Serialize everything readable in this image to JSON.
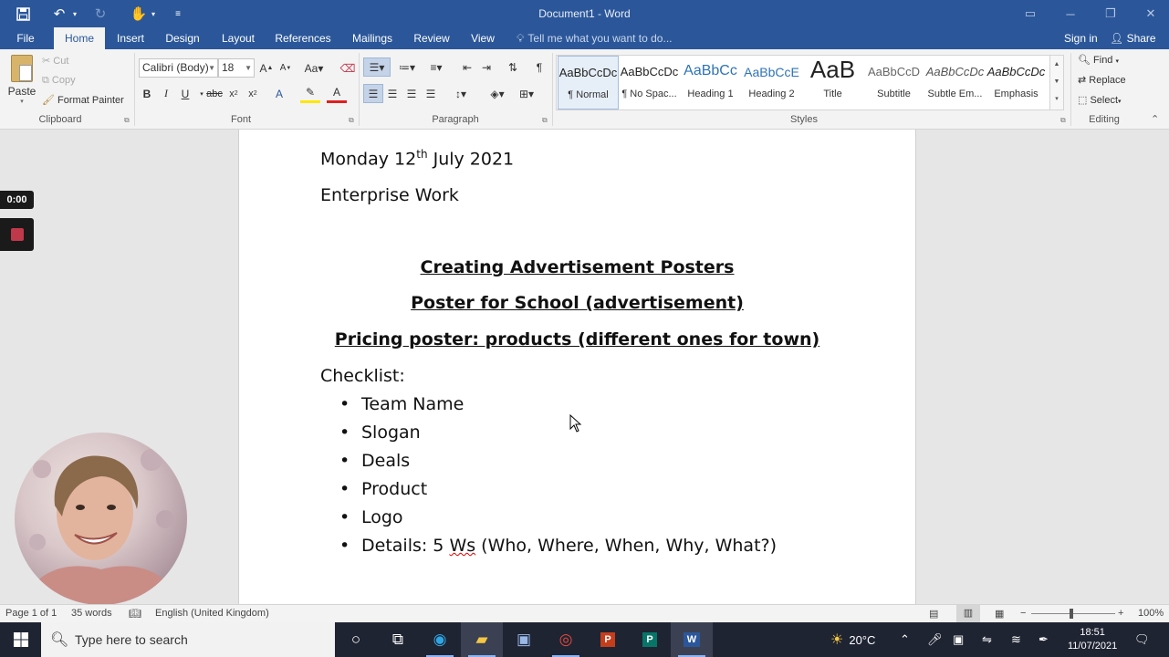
{
  "titlebar": {
    "title": "Document1 - Word",
    "qa_save_icon": "save-icon",
    "qa_undo_icon": "undo-icon",
    "qa_redo_icon": "redo-icon",
    "qa_touch_icon": "touch-mode-icon",
    "qa_customize_icon": "customize-icon"
  },
  "tabs": {
    "file": "File",
    "items": [
      "Home",
      "Insert",
      "Design",
      "Layout",
      "References",
      "Mailings",
      "Review",
      "View"
    ],
    "tell_me": "Tell me what you want to do...",
    "sign_in": "Sign in",
    "share": "Share"
  },
  "ribbon": {
    "clipboard": {
      "paste": "Paste",
      "cut": "Cut",
      "copy": "Copy",
      "format_painter": "Format Painter",
      "label": "Clipboard"
    },
    "font": {
      "font_name": "Calibri (Body)",
      "font_size": "18",
      "label": "Font"
    },
    "paragraph": {
      "label": "Paragraph"
    },
    "styles": {
      "label": "Styles",
      "items": [
        {
          "preview": "AaBbCcDc",
          "name": "¶ Normal"
        },
        {
          "preview": "AaBbCcDc",
          "name": "¶ No Spac..."
        },
        {
          "preview": "AaBbCc",
          "name": "Heading 1"
        },
        {
          "preview": "AaBbCcE",
          "name": "Heading 2"
        },
        {
          "preview": "AaB",
          "name": "Title"
        },
        {
          "preview": "AaBbCcD",
          "name": "Subtitle"
        },
        {
          "preview": "AaBbCcDc",
          "name": "Subtle Em..."
        },
        {
          "preview": "AaBbCcDc",
          "name": "Emphasis"
        }
      ]
    },
    "editing": {
      "find": "Find",
      "replace": "Replace",
      "select": "Select",
      "label": "Editing"
    }
  },
  "document": {
    "date_prefix": "Monday 12",
    "date_sup": "th",
    "date_suffix": " July 2021",
    "subtitle": "Enterprise Work",
    "heading1": "Creating Advertisement Posters",
    "heading2": "Poster for School (advertisement)",
    "heading3": "Pricing poster: products (different ones for town)",
    "checklist_label": "Checklist:",
    "checklist": [
      "Team Name",
      "Slogan",
      "Deals",
      "Product",
      "Logo"
    ],
    "details_prefix": "Details: 5 ",
    "details_misspelled": "Ws",
    "details_suffix": " (Who, Where, When, Why, What?)"
  },
  "recorder": {
    "timer": "0:00"
  },
  "statusbar": {
    "page": "Page 1 of 1",
    "words": "35 words",
    "language": "English (United Kingdom)",
    "zoom": "100%",
    "zoom_level": 1.0
  },
  "taskbar": {
    "search_placeholder": "Type here to search",
    "weather": "20°C",
    "time": "18:51",
    "date": "11/07/2021"
  },
  "colors": {
    "word_blue": "#2b579a",
    "taskbar": "#1f2433",
    "record_red": "#c0394b"
  }
}
